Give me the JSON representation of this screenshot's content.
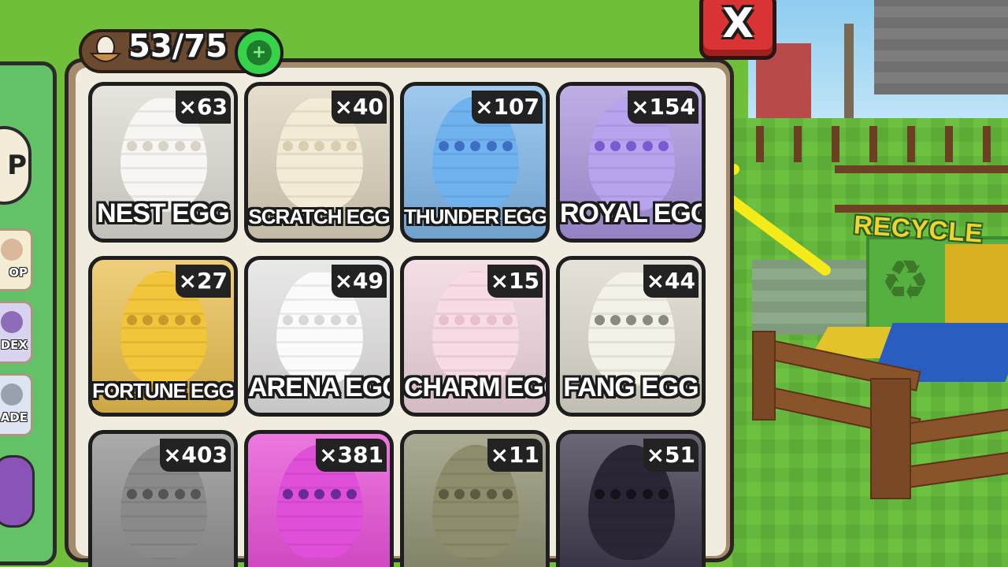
{
  "hud": {
    "egg_count": "53/75",
    "plus_label": "+",
    "close_label": "X"
  },
  "side_menu": {
    "bubble_letter": "P",
    "buttons": [
      {
        "label": "OP",
        "icon": "shop-icon"
      },
      {
        "label": "DEX",
        "icon": "index-icon"
      },
      {
        "label": "ADE",
        "icon": "trade-icon"
      }
    ]
  },
  "world": {
    "recycle_label": "RECYCLE"
  },
  "eggs": [
    {
      "name": "NEST EGG",
      "count": "×63",
      "color": "#dedbd2",
      "egg_color": "#f7f6f2",
      "dot_color": "#d8d3c6"
    },
    {
      "name": "SCRATCH EGG",
      "count": "×40",
      "color": "#ddd3bd",
      "egg_color": "#f4ebd6",
      "dot_color": "#d9cdb2"
    },
    {
      "name": "THUNDER EGG",
      "count": "×107",
      "color": "#7fb8ea",
      "egg_color": "#6fb2f0",
      "dot_color": "#3f6fc4"
    },
    {
      "name": "ROYAL EGG",
      "count": "×154",
      "color": "#a993dd",
      "egg_color": "#b8a3ef",
      "dot_color": "#7a5ad0"
    },
    {
      "name": "FORTUNE EGG",
      "count": "×27",
      "color": "#e9bf4f",
      "egg_color": "#f2c53a",
      "dot_color": "#c9982a"
    },
    {
      "name": "ARENA EGG",
      "count": "×49",
      "color": "#e3e1e1",
      "egg_color": "#fbfbfb",
      "dot_color": "#d8d8d8"
    },
    {
      "name": "CHARM EGG",
      "count": "×15",
      "color": "#f1d5de",
      "egg_color": "#f8dbe4",
      "dot_color": "#e8c0cc"
    },
    {
      "name": "FANG EGG",
      "count": "×44",
      "color": "#dcd8cc",
      "egg_color": "#f4f1e6",
      "dot_color": "#8a8a80"
    },
    {
      "name": "",
      "count": "×403",
      "color": "#8e8e8e",
      "egg_color": "#8a8a8a",
      "dot_color": "#555555"
    },
    {
      "name": "",
      "count": "×381",
      "color": "#e74bd6",
      "egg_color": "#e04fda",
      "dot_color": "#6a2a9a"
    },
    {
      "name": "",
      "count": "×11",
      "color": "#8f8f70",
      "egg_color": "#8d8d6b",
      "dot_color": "#5b5b44"
    },
    {
      "name": "",
      "count": "×51",
      "color": "#3a3448",
      "egg_color": "#2a2636",
      "dot_color": "#15121c"
    }
  ]
}
